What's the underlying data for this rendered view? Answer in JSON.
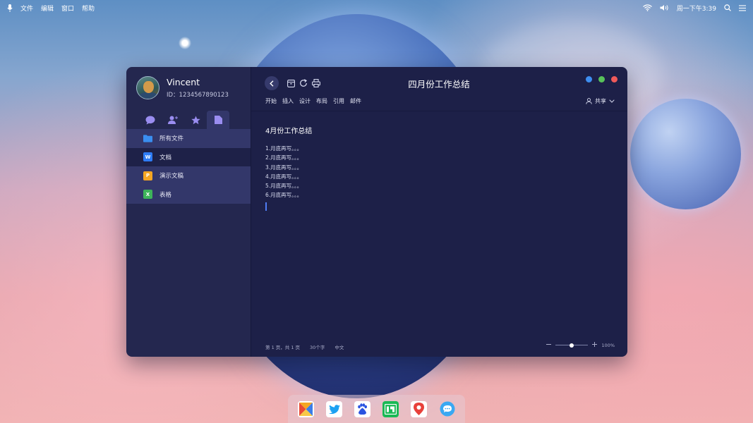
{
  "menubar": {
    "items": [
      "文件",
      "编辑",
      "窗口",
      "帮助"
    ],
    "clock": "周一下午3:39"
  },
  "profile": {
    "username": "Vincent",
    "uid": "ID：1234567890123"
  },
  "sidebar": {
    "items": [
      {
        "label": "所有文件",
        "icon": "folder-icon",
        "color": "#3a8ef0"
      },
      {
        "label": "文档",
        "icon": "word-doc-icon",
        "badge": "W",
        "color": "#2e7cf6"
      },
      {
        "label": "演示文稿",
        "icon": "presentation-icon",
        "badge": "P",
        "color": "#f5a623"
      },
      {
        "label": "表格",
        "icon": "spreadsheet-icon",
        "badge": "X",
        "color": "#3db45a"
      }
    ]
  },
  "document": {
    "title": "四月份工作总结",
    "ribbon": [
      "开始",
      "插入",
      "设计",
      "布局",
      "引用",
      "邮件"
    ],
    "share_label": "共享",
    "heading": "4月份工作总结",
    "lines": [
      "1.月底再写。。。",
      "2.月底再写。。。",
      "3.月底再写。。。",
      "4.月底再写。。。",
      "5.月底再写。。。",
      "6.月底再写。。。"
    ]
  },
  "status": {
    "page": "第 1 页，共 1 页",
    "words": "30个字",
    "language": "中文",
    "zoom": "100%",
    "zoom_slider_fraction": 0.5
  },
  "colors": {
    "close": "#f05a5a",
    "maximize": "#58c25a",
    "minimize": "#3e8ef0",
    "accent": "#4f7cf5"
  }
}
